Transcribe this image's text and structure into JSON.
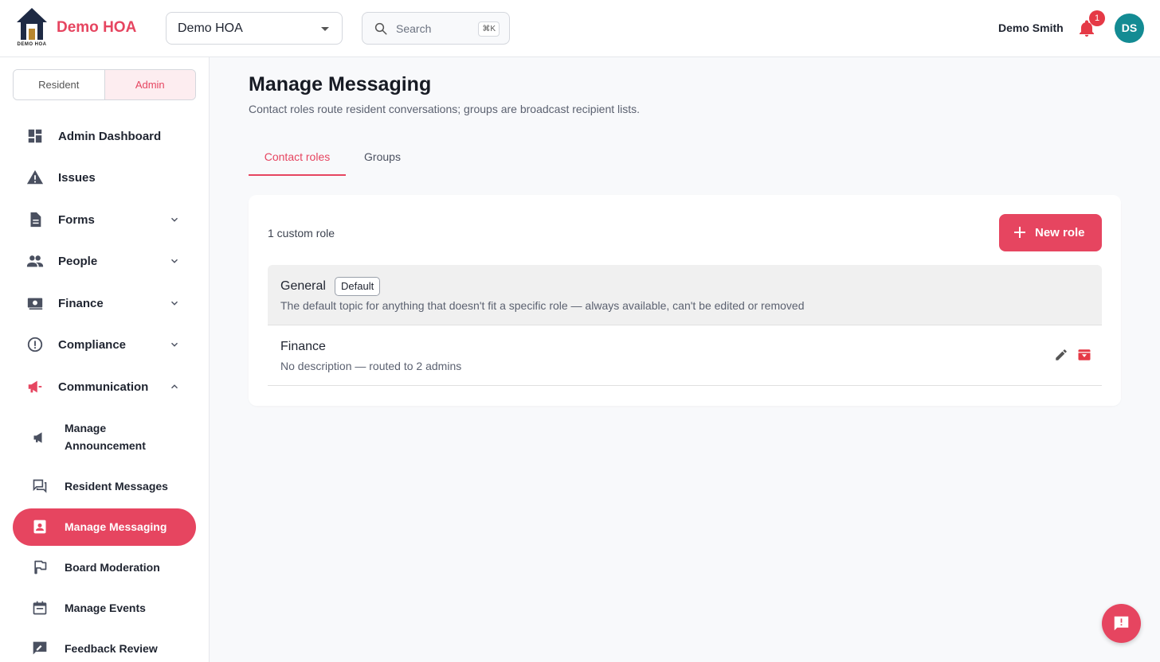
{
  "header": {
    "logo_caption": "DEMO HOA",
    "brand": "Demo HOA",
    "hoa_select": {
      "value": "Demo HOA"
    },
    "search": {
      "placeholder": "Search",
      "shortcut": "⌘K"
    },
    "user_name": "Demo Smith",
    "notification_count": "1",
    "avatar_initials": "DS"
  },
  "sidebar": {
    "mode": {
      "resident_label": "Resident",
      "admin_label": "Admin",
      "selected": "Admin"
    },
    "items": [
      {
        "label": "Admin Dashboard",
        "icon": "dashboard-icon"
      },
      {
        "label": "Issues",
        "icon": "warning-icon"
      },
      {
        "label": "Forms",
        "icon": "document-icon",
        "expandable": true
      },
      {
        "label": "People",
        "icon": "people-icon",
        "expandable": true
      },
      {
        "label": "Finance",
        "icon": "money-icon",
        "expandable": true
      },
      {
        "label": "Compliance",
        "icon": "alert-circle-icon",
        "expandable": true
      },
      {
        "label": "Communication",
        "icon": "megaphone-icon",
        "expandable": true,
        "expanded": true
      }
    ],
    "sub_items": [
      {
        "label": "Manage Announcement",
        "icon": "megaphone-icon"
      },
      {
        "label": "Resident Messages",
        "icon": "forum-icon"
      },
      {
        "label": "Manage Messaging",
        "icon": "contact-card-icon",
        "active": true
      },
      {
        "label": "Board Moderation",
        "icon": "flag-icon"
      },
      {
        "label": "Manage Events",
        "icon": "calendar-icon"
      },
      {
        "label": "Feedback Review",
        "icon": "feedback-icon"
      }
    ]
  },
  "main": {
    "title": "Manage Messaging",
    "subtitle": "Contact roles route resident conversations; groups are broadcast recipient lists.",
    "tabs": [
      {
        "label": "Contact roles",
        "active": true
      },
      {
        "label": "Groups",
        "active": false
      }
    ],
    "card": {
      "count_label": "1 custom role",
      "new_button_label": "New role",
      "roles": [
        {
          "name": "General",
          "badge": "Default",
          "description": "The default topic for anything that doesn't fit a specific role — always available, can't be edited or removed"
        },
        {
          "name": "Finance",
          "description": "No description — routed to 2 admins"
        }
      ]
    }
  },
  "colors": {
    "accent": "#e64560",
    "avatar_bg": "#138b93",
    "badge_red": "#e53946"
  }
}
